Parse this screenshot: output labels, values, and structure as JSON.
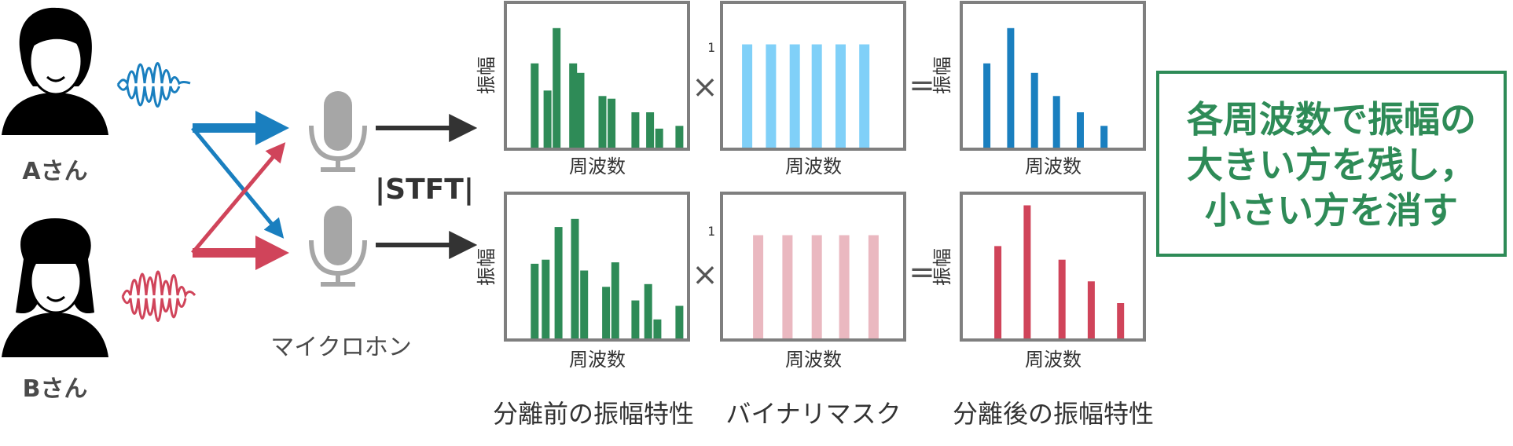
{
  "persons": {
    "a_label": "Aさん",
    "b_label": "Bさん"
  },
  "mic_label": "マイクロホン",
  "stft_label": "|STFT|",
  "axis": {
    "x_label": "周波数",
    "y_label": "振幅"
  },
  "captions": {
    "before": "分離前の振幅特性",
    "mask": "バイナリマスク",
    "after": "分離後の振幅特性"
  },
  "operators": {
    "times": "×",
    "equals": "="
  },
  "mask_tick": "1",
  "note_lines": [
    "各周波数で振幅の",
    "大きい方を残し，",
    "小さい方を消す"
  ],
  "colors": {
    "a_blue": "#1a7fbf",
    "b_red": "#d0445a",
    "green": "#2e8b57",
    "mask_a": "#80d0f8",
    "mask_b": "#eab8c0",
    "frame": "#7f7f7f",
    "mic": "#a6a6a6"
  },
  "chart_data": [
    {
      "type": "bar",
      "id": "before_mic1",
      "color": "#2e8b57",
      "values": [
        0.62,
        0.42,
        0.88,
        0.62,
        0.55,
        0.38,
        0.36,
        0.26,
        0.26,
        0.14,
        0.16
      ],
      "x_positions": [
        0.16,
        0.23,
        0.28,
        0.37,
        0.41,
        0.53,
        0.58,
        0.71,
        0.79,
        0.84,
        0.95
      ]
    },
    {
      "type": "bar",
      "id": "mask_mic1",
      "color": "#80d0f8",
      "values": [
        1,
        1,
        1,
        1,
        1,
        1
      ],
      "x_positions": [
        0.14,
        0.27,
        0.4,
        0.52,
        0.65,
        0.78
      ]
    },
    {
      "type": "bar",
      "id": "after_mic1",
      "color": "#1a7fbf",
      "values": [
        0.62,
        0.88,
        0.55,
        0.38,
        0.26,
        0.16
      ],
      "x_positions": [
        0.14,
        0.27,
        0.4,
        0.52,
        0.65,
        0.78
      ]
    },
    {
      "type": "bar",
      "id": "before_mic2",
      "color": "#2e8b57",
      "values": [
        0.55,
        0.58,
        0.82,
        0.88,
        0.5,
        0.38,
        0.56,
        0.28,
        0.4,
        0.14,
        0.24
      ],
      "x_positions": [
        0.16,
        0.22,
        0.29,
        0.38,
        0.43,
        0.55,
        0.6,
        0.71,
        0.78,
        0.83,
        0.95
      ]
    },
    {
      "type": "bar",
      "id": "mask_mic2",
      "color": "#eab8c0",
      "values": [
        1,
        1,
        1,
        1,
        1
      ],
      "x_positions": [
        0.2,
        0.36,
        0.52,
        0.67,
        0.83
      ]
    },
    {
      "type": "bar",
      "id": "after_mic2",
      "color": "#d0445a",
      "values": [
        0.68,
        0.98,
        0.58,
        0.42,
        0.26
      ],
      "x_positions": [
        0.2,
        0.36,
        0.55,
        0.71,
        0.87
      ]
    }
  ]
}
